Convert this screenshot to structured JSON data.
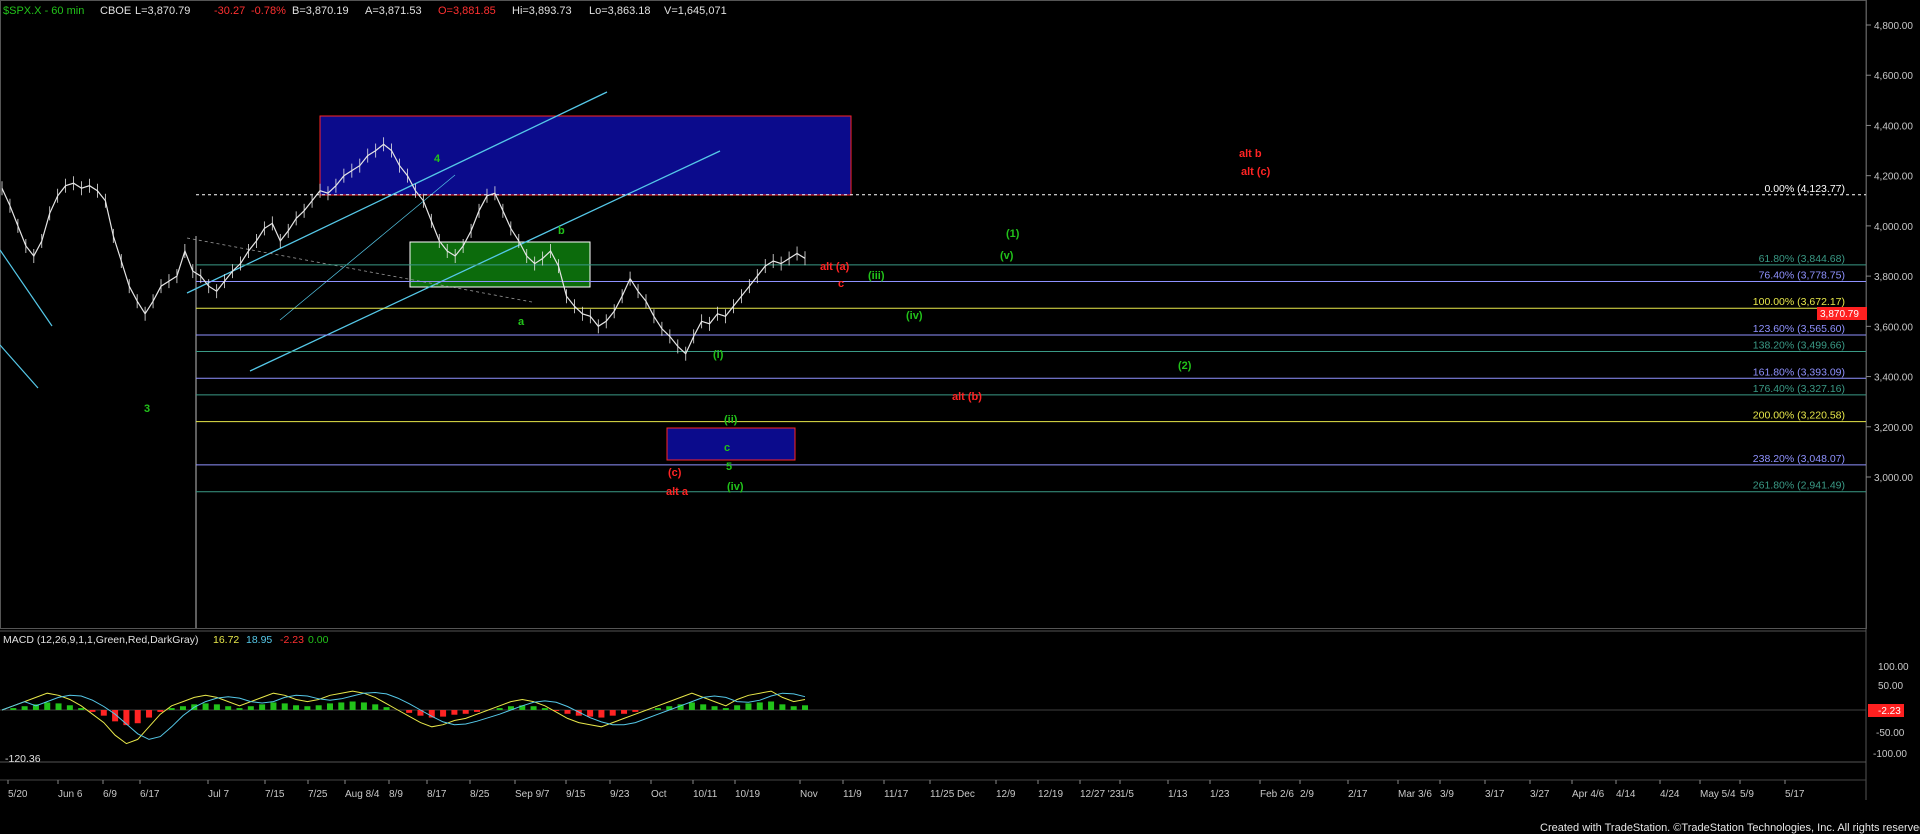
{
  "header": {
    "symbol": "$SPX.X - 60 min",
    "exchange": "CBOE",
    "last": "L=3,870.79",
    "change": "-30.27",
    "pct": "-0.78%",
    "bid": "B=3,870.19",
    "ask": "A=3,871.53",
    "open": "O=3,881.85",
    "high": "Hi=3,893.73",
    "low": "Lo=3,863.18",
    "volume": "V=1,645,071"
  },
  "macd": {
    "label": "MACD (12,26,9,1,1,Green,Red,DarkGray)",
    "v1": "16.72",
    "v2": "18.95",
    "v3": "-2.23",
    "v4": "0.00",
    "low_readout": "-120.36",
    "current_badge": "-2.23",
    "ticks": [
      "100.00",
      "50.00",
      "-50.00",
      "-100.00"
    ]
  },
  "footer": {
    "credit": "Created with TradeStation. ©TradeStation Technologies, Inc. All rights reserved."
  },
  "price_badge": "3,870.79",
  "colors": {
    "bg": "#000000",
    "candle": "#e6e6e6",
    "wave_green": "#22c21a",
    "wave_red": "#ff2424",
    "channel": "#55c8e8",
    "blue_box": "#0b0b8c",
    "green_box": "#0c6b0c"
  },
  "chart_data": {
    "type": "line",
    "yticks": [
      "4,800.00",
      "4,600.00",
      "4,400.00",
      "4,200.00",
      "4,000.00",
      "3,800.00",
      "3,600.00",
      "3,400.00",
      "3,200.00",
      "3,000.00"
    ],
    "ylim": [
      2880,
      4880
    ],
    "xticks": [
      "5/20",
      "Jun 6",
      "6/9",
      "6/17",
      "Jul 7",
      "7/15",
      "7/25",
      "Aug 8/4",
      "8/9",
      "8/17",
      "8/25",
      "Sep 9/7",
      "9/15",
      "9/23",
      "Oct",
      "10/11",
      "10/19",
      "Nov",
      "11/9",
      "11/17",
      "11/25 Dec",
      "12/9",
      "12/19",
      "12/27 '23",
      "1/5",
      "1/13",
      "1/23",
      "Feb 2/6",
      "2/9",
      "2/17",
      "Mar 3/6",
      "3/9",
      "3/17",
      "3/27",
      "Apr 4/6",
      "4/14",
      "4/24",
      "May 5/4",
      "5/9",
      "5/17"
    ],
    "series": [
      {
        "values": [
          4150,
          4080,
          4000,
          3920,
          3880,
          3940,
          4050,
          4120,
          4160,
          4170,
          4150,
          4160,
          4140,
          4100,
          3960,
          3860,
          3760,
          3700,
          3650,
          3700,
          3760,
          3780,
          3800,
          3900,
          3820,
          3800,
          3760,
          3740,
          3780,
          3820,
          3850,
          3900,
          3940,
          3990,
          4010,
          3940,
          3980,
          4030,
          4060,
          4100,
          4140,
          4130,
          4160,
          4200,
          4220,
          4240,
          4280,
          4300,
          4325,
          4300,
          4240,
          4200,
          4140,
          4100,
          4020,
          3940,
          3900,
          3880,
          3920,
          3980,
          4060,
          4120,
          4130,
          4060,
          3990,
          3940,
          3880,
          3850,
          3870,
          3900,
          3840,
          3720,
          3680,
          3650,
          3640,
          3600,
          3620,
          3660,
          3720,
          3790,
          3740,
          3700,
          3640,
          3590,
          3560,
          3520,
          3491,
          3560,
          3620,
          3610,
          3650,
          3640,
          3680,
          3720,
          3760,
          3800,
          3840,
          3860,
          3850,
          3870,
          3890,
          3871
        ]
      }
    ],
    "fib_levels": [
      {
        "label": "0.00% (4,123.77)",
        "value": 4123.77,
        "color": "#ffffff"
      },
      {
        "label": "61.80% (3,844.68)",
        "value": 3844.68,
        "color": "#3a9a86"
      },
      {
        "label": "76.40% (3,778.75)",
        "value": 3778.75,
        "color": "#8f92ff"
      },
      {
        "label": "100.00% (3,672.17)",
        "value": 3672.17,
        "color": "#e8e84a"
      },
      {
        "label": "123.60% (3,565.60)",
        "value": 3565.6,
        "color": "#8f92ff"
      },
      {
        "label": "138.20% (3,499.66)",
        "value": 3499.66,
        "color": "#3a9a86"
      },
      {
        "label": "161.80% (3,393.09)",
        "value": 3393.09,
        "color": "#8f92ff"
      },
      {
        "label": "176.40% (3,327.16)",
        "value": 3327.16,
        "color": "#3a9a86"
      },
      {
        "label": "200.00% (3,220.58)",
        "value": 3220.58,
        "color": "#e8e84a"
      },
      {
        "label": "238.20% (3,048.07)",
        "value": 3048.07,
        "color": "#8f92ff"
      },
      {
        "label": "261.80% (2,941.49)",
        "value": 2941.49,
        "color": "#3a9a86"
      }
    ],
    "wave_labels": [
      {
        "text": "3",
        "color": "green"
      },
      {
        "text": "4",
        "color": "green"
      },
      {
        "text": "a",
        "color": "green"
      },
      {
        "text": "b",
        "color": "green"
      },
      {
        "text": "(i)",
        "color": "green"
      },
      {
        "text": "(ii)",
        "color": "green"
      },
      {
        "text": "c",
        "color": "green"
      },
      {
        "text": "5",
        "color": "green"
      },
      {
        "text": "(iv)",
        "color": "green"
      },
      {
        "text": "(iii)",
        "color": "green"
      },
      {
        "text": "(iv)",
        "color": "green"
      },
      {
        "text": "(v)",
        "color": "green"
      },
      {
        "text": "(1)",
        "color": "green"
      },
      {
        "text": "(2)",
        "color": "green"
      },
      {
        "text": "(c)",
        "color": "red"
      },
      {
        "text": "alt a",
        "color": "red"
      },
      {
        "text": "alt (a)",
        "color": "red"
      },
      {
        "text": "c",
        "color": "red"
      },
      {
        "text": "alt (b)",
        "color": "red"
      },
      {
        "text": "alt b",
        "color": "red"
      },
      {
        "text": "alt (c)",
        "color": "red"
      }
    ],
    "macd_series": [
      0,
      10,
      20,
      30,
      40,
      35,
      25,
      10,
      -10,
      -30,
      -60,
      -80,
      -70,
      -40,
      -10,
      10,
      20,
      30,
      35,
      30,
      20,
      10,
      20,
      30,
      40,
      35,
      25,
      20,
      25,
      35,
      40,
      45,
      40,
      30,
      15,
      0,
      -15,
      -30,
      -40,
      -35,
      -25,
      -20,
      -10,
      0,
      10,
      20,
      25,
      20,
      10,
      -5,
      -20,
      -30,
      -35,
      -40,
      -30,
      -20,
      -10,
      0,
      10,
      20,
      30,
      40,
      30,
      20,
      10,
      25,
      35,
      40,
      45,
      30,
      20,
      25
    ]
  }
}
